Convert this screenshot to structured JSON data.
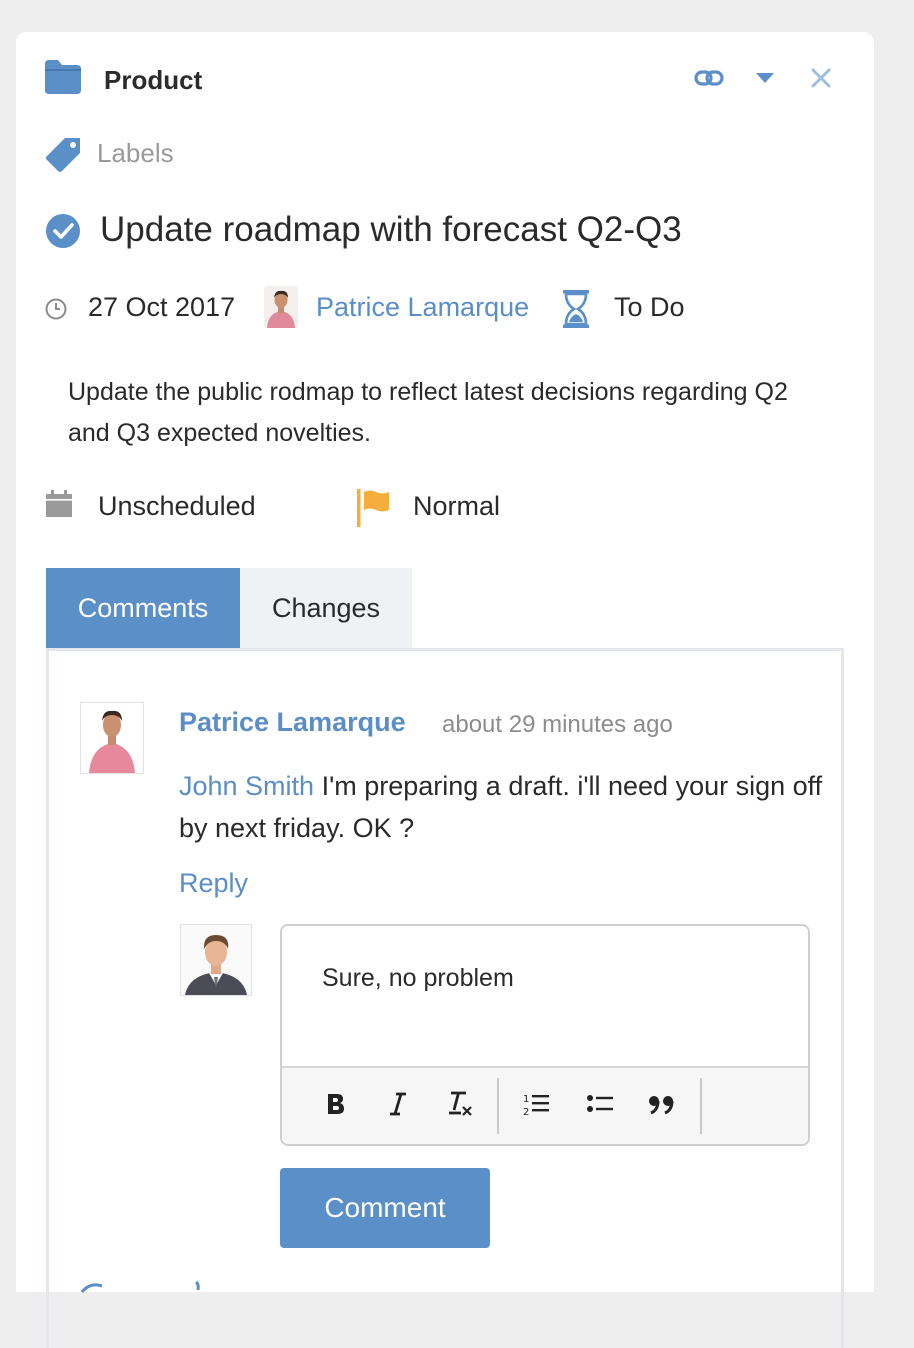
{
  "header": {
    "project": "Product",
    "link_icon": "link-icon",
    "dropdown_icon": "caret-down-icon",
    "close_icon": "close-icon"
  },
  "labels": {
    "text": "Labels"
  },
  "task": {
    "title": "Update roadmap with forecast Q2-Q3",
    "date": "27 Oct 2017",
    "assignee": "Patrice Lamarque",
    "status": "To Do",
    "description": "Update the public rodmap to reflect latest decisions regarding Q2 and Q3 expected novelties.",
    "schedule": "Unscheduled",
    "priority": "Normal"
  },
  "tabs": [
    {
      "label": "Comments",
      "active": true
    },
    {
      "label": "Changes",
      "active": false
    }
  ],
  "comment": {
    "author": "Patrice Lamarque",
    "time": "about 29 minutes ago",
    "mention": "John Smith",
    "text": " I'm preparing a draft. i'll need your sign off by next friday. OK ?",
    "reply_label": "Reply"
  },
  "editor": {
    "value": "Sure, no problem",
    "toolbar": [
      "bold",
      "italic",
      "remove-format",
      "numbered-list",
      "bulleted-list",
      "blockquote"
    ]
  },
  "submit": {
    "label": "Comment"
  },
  "colors": {
    "accent": "#5a8fc8",
    "link": "#5b8ec6",
    "flag": "#f5ad3c",
    "muted": "#9a9a9a"
  }
}
